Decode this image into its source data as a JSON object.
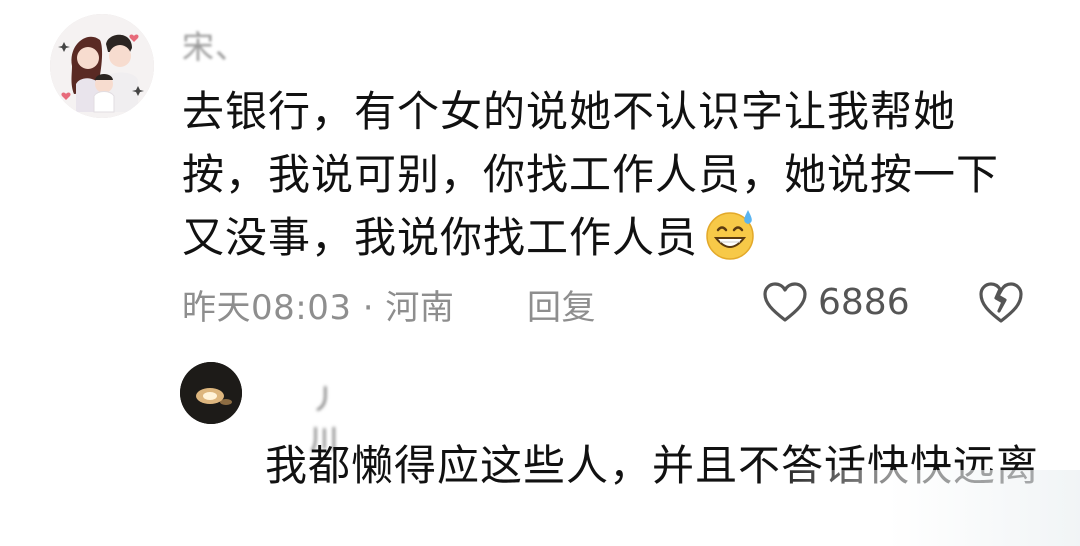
{
  "comment": {
    "username": "宋、",
    "text": "去银行，有个女的说她不认识字让我帮她按，我说可别，你找工作人员，她说按一下又没事，我说你找工作人员",
    "emoji": "sweat-smile-emoji",
    "time_location": "昨天08:03 · 河南",
    "reply_label": "回复",
    "like_count": "6886",
    "icons": {
      "like": "heart-outline-icon",
      "dislike": "broken-heart-icon"
    }
  },
  "reply": {
    "username": "丿川",
    "text": "我都懒得应这些人，并且不答话快快远离"
  },
  "colors": {
    "text": "#111111",
    "meta": "#8e8e8e",
    "emoji": "#f7c948"
  }
}
